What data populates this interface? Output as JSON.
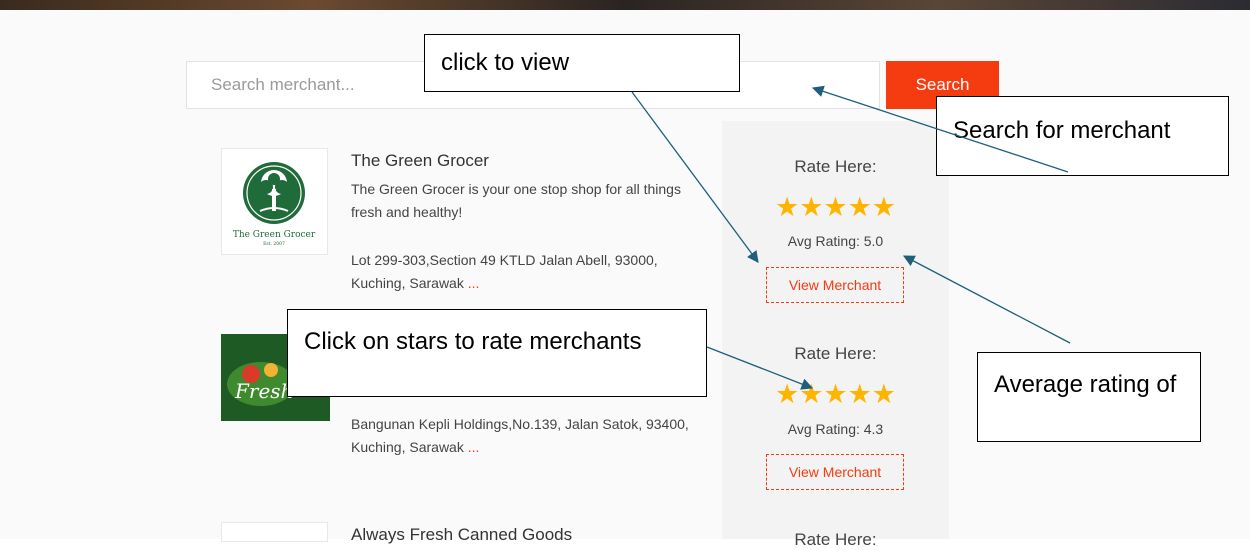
{
  "search": {
    "placeholder": "Search merchant...",
    "button_label": "Search"
  },
  "merchants": [
    {
      "name": "The Green Grocer",
      "description": "The Green Grocer is your one stop shop for all things fresh and healthy!",
      "address": "Lot 299-303,Section 49 KTLD Jalan Abell, 93000, Kuching, Sarawak",
      "more": "...",
      "logo_text": "The Green Grocer",
      "logo_subtext": "Est. 2007",
      "rate_label": "Rate Here:",
      "stars": "★★★★★",
      "avg_rating": "Avg Rating: 5.0",
      "view_label": "View Merchant"
    },
    {
      "name": "",
      "address": "Bangunan Kepli Holdings,No.139, Jalan Satok, 93400, Kuching, Sarawak",
      "more": "...",
      "logo_text": "Fresh",
      "rate_label": "Rate Here:",
      "stars": "★★★★★",
      "avg_rating": "Avg Rating: 4.3",
      "view_label": "View Merchant"
    },
    {
      "name": "Always Fresh Canned Goods",
      "rate_label": "Rate Here:"
    }
  ],
  "annotations": {
    "click_to_view": "click to view",
    "search_for_merchant": "Search for merchant",
    "click_stars": "Click on stars to rate merchants",
    "average_rating": "Average rating of"
  },
  "colors": {
    "accent": "#f53b10",
    "star": "#ffb400",
    "arrow": "#1f5f7a"
  }
}
